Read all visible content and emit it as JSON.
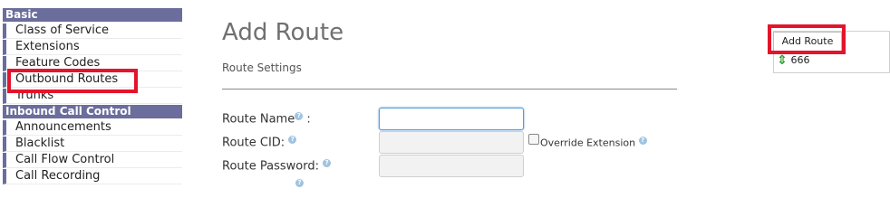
{
  "sidebar": {
    "categories": [
      {
        "header": "Basic",
        "items": [
          "Class of Service",
          "Extensions",
          "Feature Codes",
          "Outbound Routes",
          "Trunks"
        ]
      },
      {
        "header": "Inbound Call Control",
        "items": [
          "Announcements",
          "Blacklist",
          "Call Flow Control",
          "Call Recording"
        ]
      }
    ]
  },
  "main": {
    "title": "Add Route",
    "section": "Route Settings",
    "fields": {
      "route_name": {
        "label": "Route Name",
        "value": ""
      },
      "route_cid": {
        "label": "Route CID:",
        "value": ""
      },
      "route_password": {
        "label": "Route Password:",
        "value": ""
      }
    },
    "override_extension_label": "Override Extension",
    "help_glyph": "?"
  },
  "right_panel": {
    "add_route_label": "Add Route",
    "routes": [
      {
        "name": "666",
        "icon": "up-down-arrow-icon"
      }
    ]
  },
  "colors": {
    "sidebar_accent": "#6b6d9c",
    "highlight": "#e2152c",
    "help_icon": "#9fc3e0",
    "sort_icon": "#2e9b2e"
  }
}
